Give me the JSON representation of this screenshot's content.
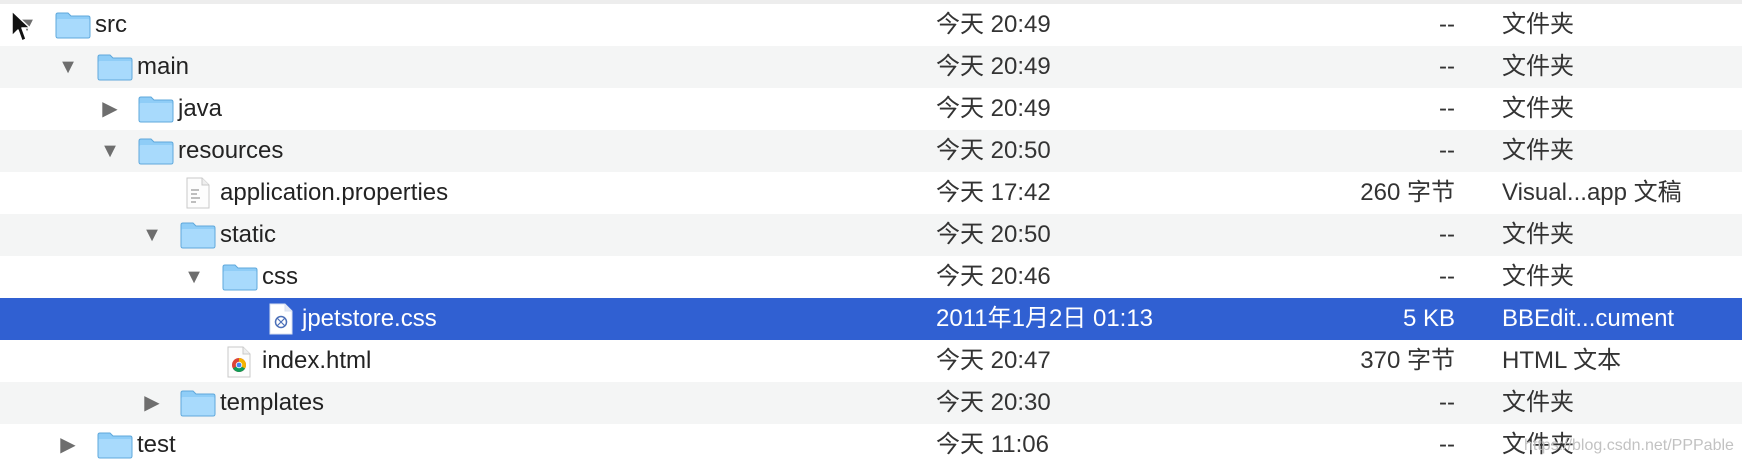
{
  "rows": [
    {
      "name": "src",
      "date": "今天 20:49",
      "size": "--",
      "kind": "文件夹"
    },
    {
      "name": "main",
      "date": "今天 20:49",
      "size": "--",
      "kind": "文件夹"
    },
    {
      "name": "java",
      "date": "今天 20:49",
      "size": "--",
      "kind": "文件夹"
    },
    {
      "name": "resources",
      "date": "今天 20:50",
      "size": "--",
      "kind": "文件夹"
    },
    {
      "name": "application.properties",
      "date": "今天 17:42",
      "size": "260 字节",
      "kind": "Visual...app 文稿"
    },
    {
      "name": "static",
      "date": "今天 20:50",
      "size": "--",
      "kind": "文件夹"
    },
    {
      "name": "css",
      "date": "今天 20:46",
      "size": "--",
      "kind": "文件夹"
    },
    {
      "name": "jpetstore.css",
      "date": "2011年1月2日 01:13",
      "size": "5 KB",
      "kind": "BBEdit...cument"
    },
    {
      "name": "index.html",
      "date": "今天 20:47",
      "size": "370 字节",
      "kind": "HTML 文本"
    },
    {
      "name": "templates",
      "date": "今天 20:30",
      "size": "--",
      "kind": "文件夹"
    },
    {
      "name": "test",
      "date": "今天 11:06",
      "size": "--",
      "kind": "文件夹"
    }
  ],
  "watermark": "https://blog.csdn.net/PPPable",
  "colors": {
    "selection": "#3060d2",
    "folder": "#8fcdf7",
    "alternate_row": "#f4f5f5"
  }
}
